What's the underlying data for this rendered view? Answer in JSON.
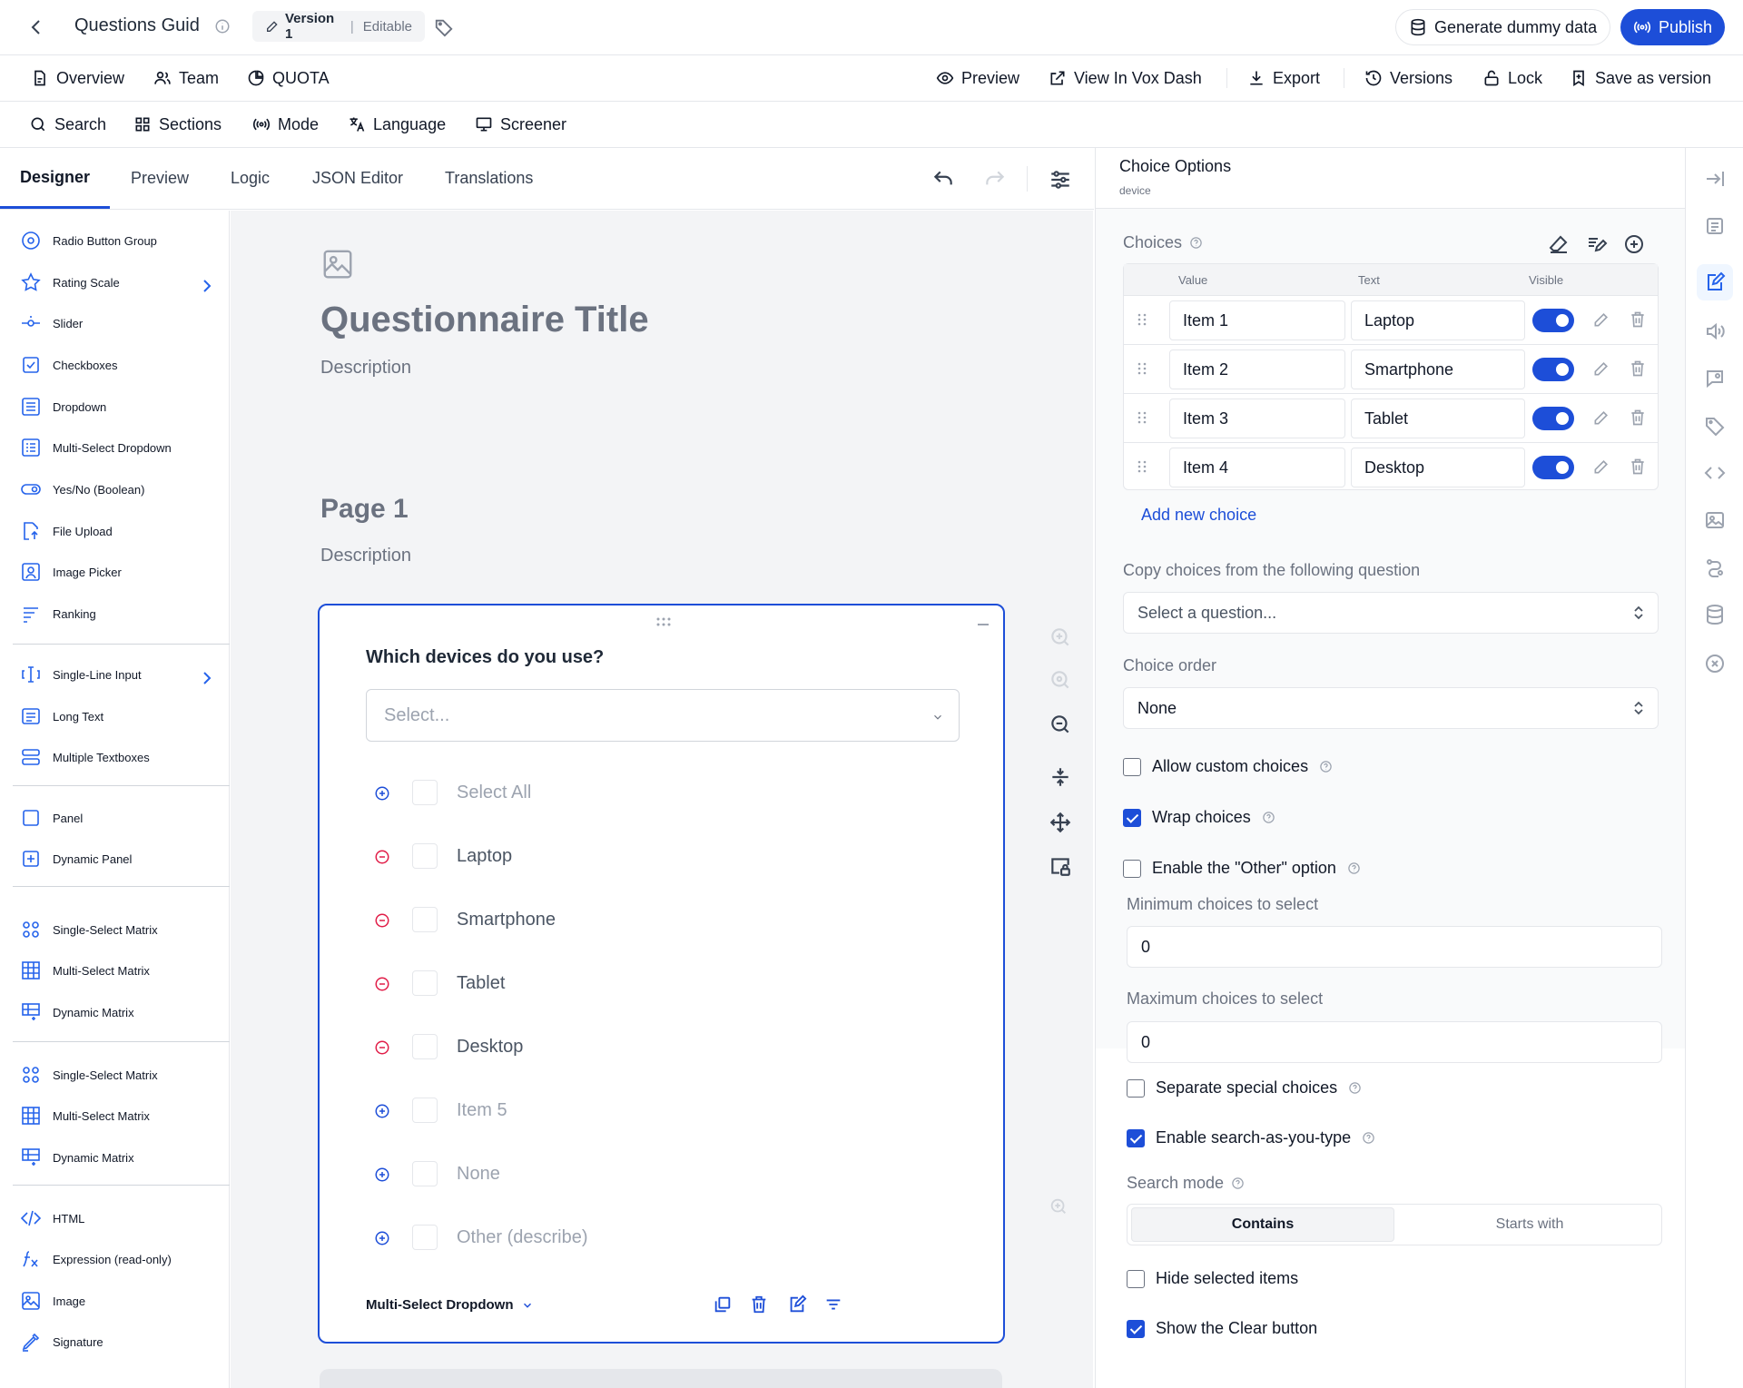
{
  "topbar": {
    "title": "Questions Guid",
    "version_label": "Version 1",
    "version_status": "Editable",
    "generate_label": "Generate dummy data",
    "publish_label": "Publish"
  },
  "nav1": {
    "overview": "Overview",
    "team": "Team",
    "quota": "QUOTA",
    "preview": "Preview",
    "view_vox": "View In Vox Dash",
    "export": "Export",
    "versions": "Versions",
    "lock": "Lock",
    "save_version": "Save as version"
  },
  "nav2": {
    "search": "Search",
    "sections": "Sections",
    "mode": "Mode",
    "language": "Language",
    "screener": "Screener"
  },
  "tabs": [
    "Designer",
    "Preview",
    "Logic",
    "JSON Editor",
    "Translations"
  ],
  "toolbox": [
    {
      "label": "Radio Button Group",
      "icon": "radio-icon"
    },
    {
      "label": "Rating Scale",
      "icon": "star-icon",
      "chevron": true
    },
    {
      "label": "Slider",
      "icon": "slider-icon"
    },
    {
      "label": "Checkboxes",
      "icon": "checkbox-icon"
    },
    {
      "label": "Dropdown",
      "icon": "dropdown-icon"
    },
    {
      "label": "Multi-Select Dropdown",
      "icon": "multi-dropdown-icon"
    },
    {
      "label": "Yes/No (Boolean)",
      "icon": "toggle-icon"
    },
    {
      "label": "File Upload",
      "icon": "file-upload-icon"
    },
    {
      "label": "Image Picker",
      "icon": "image-picker-icon"
    },
    {
      "label": "Ranking",
      "icon": "ranking-icon"
    },
    {
      "label": "Single-Line Input",
      "icon": "text-input-icon",
      "chevron": true
    },
    {
      "label": "Long Text",
      "icon": "long-text-icon"
    },
    {
      "label": "Multiple Textboxes",
      "icon": "multi-text-icon"
    },
    {
      "label": "Panel",
      "icon": "panel-icon"
    },
    {
      "label": "Dynamic Panel",
      "icon": "dynamic-panel-icon"
    },
    {
      "label": "Single-Select Matrix",
      "icon": "matrix-single-icon"
    },
    {
      "label": "Multi-Select Matrix",
      "icon": "matrix-multi-icon"
    },
    {
      "label": "Dynamic Matrix",
      "icon": "matrix-dynamic-icon"
    },
    {
      "label": "Single-Select Matrix",
      "icon": "matrix-single-icon"
    },
    {
      "label": "Multi-Select Matrix",
      "icon": "matrix-multi-icon"
    },
    {
      "label": "Dynamic Matrix",
      "icon": "matrix-dynamic-icon"
    },
    {
      "label": "HTML",
      "icon": "html-icon"
    },
    {
      "label": "Expression (read-only)",
      "icon": "expression-icon"
    },
    {
      "label": "Image",
      "icon": "image-icon"
    },
    {
      "label": "Signature",
      "icon": "signature-icon"
    }
  ],
  "survey": {
    "title": "Questionnaire Title",
    "description": "Description",
    "page_title": "Page 1",
    "page_description": "Description"
  },
  "question": {
    "title": "Which devices do you use?",
    "placeholder": "Select...",
    "choices": [
      {
        "label": "Select All",
        "state": "add"
      },
      {
        "label": "Laptop",
        "state": "remove"
      },
      {
        "label": "Smartphone",
        "state": "remove"
      },
      {
        "label": "Tablet",
        "state": "remove"
      },
      {
        "label": "Desktop",
        "state": "remove"
      },
      {
        "label": "Item 5",
        "state": "add"
      },
      {
        "label": "None",
        "state": "add"
      },
      {
        "label": "Other (describe)",
        "state": "add"
      }
    ],
    "type_label": "Multi-Select Dropdown"
  },
  "props": {
    "title": "Choice Options",
    "subtitle": "device",
    "choices_label": "Choices",
    "col_value": "Value",
    "col_text": "Text",
    "col_visible": "Visible",
    "rows": [
      {
        "value": "Item 1",
        "text": "Laptop"
      },
      {
        "value": "Item 2",
        "text": "Smartphone"
      },
      {
        "value": "Item 3",
        "text": "Tablet"
      },
      {
        "value": "Item 4",
        "text": "Desktop"
      }
    ],
    "add_choice": "Add new choice",
    "copy_label": "Copy choices from the following question",
    "copy_placeholder": "Select a question...",
    "order_label": "Choice order",
    "order_value": "None",
    "allow_custom": "Allow custom choices",
    "wrap_choices": "Wrap choices",
    "enable_other": "Enable the \"Other\" option",
    "min_label": "Minimum choices to select",
    "min_value": "0",
    "max_label": "Maximum choices to select",
    "max_value": "0",
    "separate_special": "Separate special choices",
    "enable_search": "Enable search-as-you-type",
    "search_mode_label": "Search mode",
    "search_contains": "Contains",
    "search_starts": "Starts with",
    "hide_selected": "Hide selected items",
    "show_clear": "Show the Clear button"
  },
  "colors": {
    "accent": "#1d4ed8",
    "add": "#1d4ed8",
    "remove": "#e11d48"
  }
}
